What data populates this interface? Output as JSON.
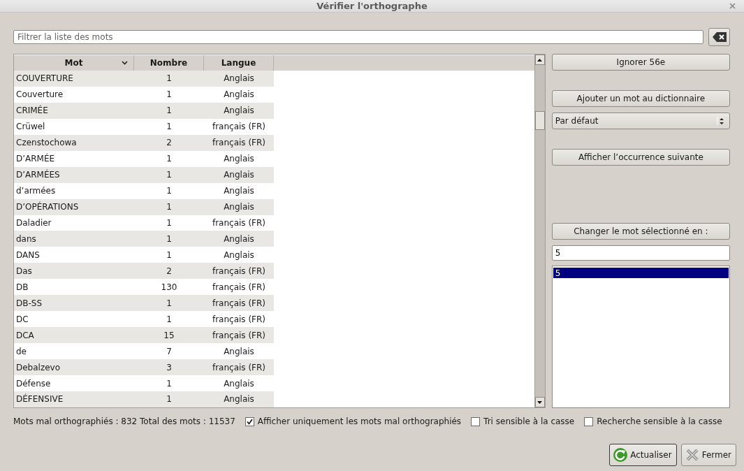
{
  "window": {
    "title": "Vérifier l'orthographe"
  },
  "filter": {
    "placeholder": "Filtrer la liste des mots"
  },
  "table": {
    "columns": [
      {
        "label": "Mot",
        "sorted": true
      },
      {
        "label": "Nombre",
        "sorted": false
      },
      {
        "label": "Langue",
        "sorted": false
      }
    ],
    "rows": [
      {
        "word": "COUVERTURE",
        "count": "1",
        "language": "Anglais"
      },
      {
        "word": "Couverture",
        "count": "1",
        "language": "Anglais"
      },
      {
        "word": "CRIMÉE",
        "count": "1",
        "language": "Anglais"
      },
      {
        "word": "Crüwel",
        "count": "1",
        "language": "français (FR)"
      },
      {
        "word": "Czenstochowa",
        "count": "2",
        "language": "français (FR)"
      },
      {
        "word": "D’ARMÉE",
        "count": "1",
        "language": "Anglais"
      },
      {
        "word": "D’ARMÉES",
        "count": "1",
        "language": "Anglais"
      },
      {
        "word": "d’armées",
        "count": "1",
        "language": "Anglais"
      },
      {
        "word": "D’OPÉRATIONS",
        "count": "1",
        "language": "Anglais"
      },
      {
        "word": "Daladier",
        "count": "1",
        "language": "français (FR)"
      },
      {
        "word": "dans",
        "count": "1",
        "language": "Anglais"
      },
      {
        "word": "DANS",
        "count": "1",
        "language": "Anglais"
      },
      {
        "word": "Das",
        "count": "2",
        "language": "français (FR)"
      },
      {
        "word": "DB",
        "count": "130",
        "language": "français (FR)"
      },
      {
        "word": "DB-SS",
        "count": "1",
        "language": "français (FR)"
      },
      {
        "word": "DC",
        "count": "1",
        "language": "français (FR)"
      },
      {
        "word": "DCA",
        "count": "15",
        "language": "français (FR)"
      },
      {
        "word": "de",
        "count": "7",
        "language": "Anglais"
      },
      {
        "word": "Debalzevo",
        "count": "3",
        "language": "français (FR)"
      },
      {
        "word": "Défense",
        "count": "1",
        "language": "Anglais"
      },
      {
        "word": "DÉFENSIVE",
        "count": "1",
        "language": "Anglais"
      }
    ]
  },
  "actions": {
    "ignore": "Ignorer 56e",
    "add": "Ajouter un mot au dictionnaire",
    "dictionary": "Par défaut",
    "next": "Afficher l’occurrence suivante",
    "change": "Changer le mot sélectionné en :",
    "replacement": "5",
    "suggestions": [
      {
        "text": "5",
        "selected": true
      }
    ]
  },
  "status": {
    "summary": "Mots mal orthographiés : 832 Total des mots : 11537",
    "options": [
      {
        "label": "Afficher uniquement les mots mal orthographiés",
        "checked": true
      },
      {
        "label": "Tri sensible à la casse",
        "checked": false
      },
      {
        "label": "Recherche sensible à la casse",
        "checked": false
      }
    ]
  },
  "buttons": [
    {
      "label": "Actualiser",
      "kind": "refresh",
      "default": true
    },
    {
      "label": "Fermer",
      "kind": "close",
      "default": false
    }
  ]
}
